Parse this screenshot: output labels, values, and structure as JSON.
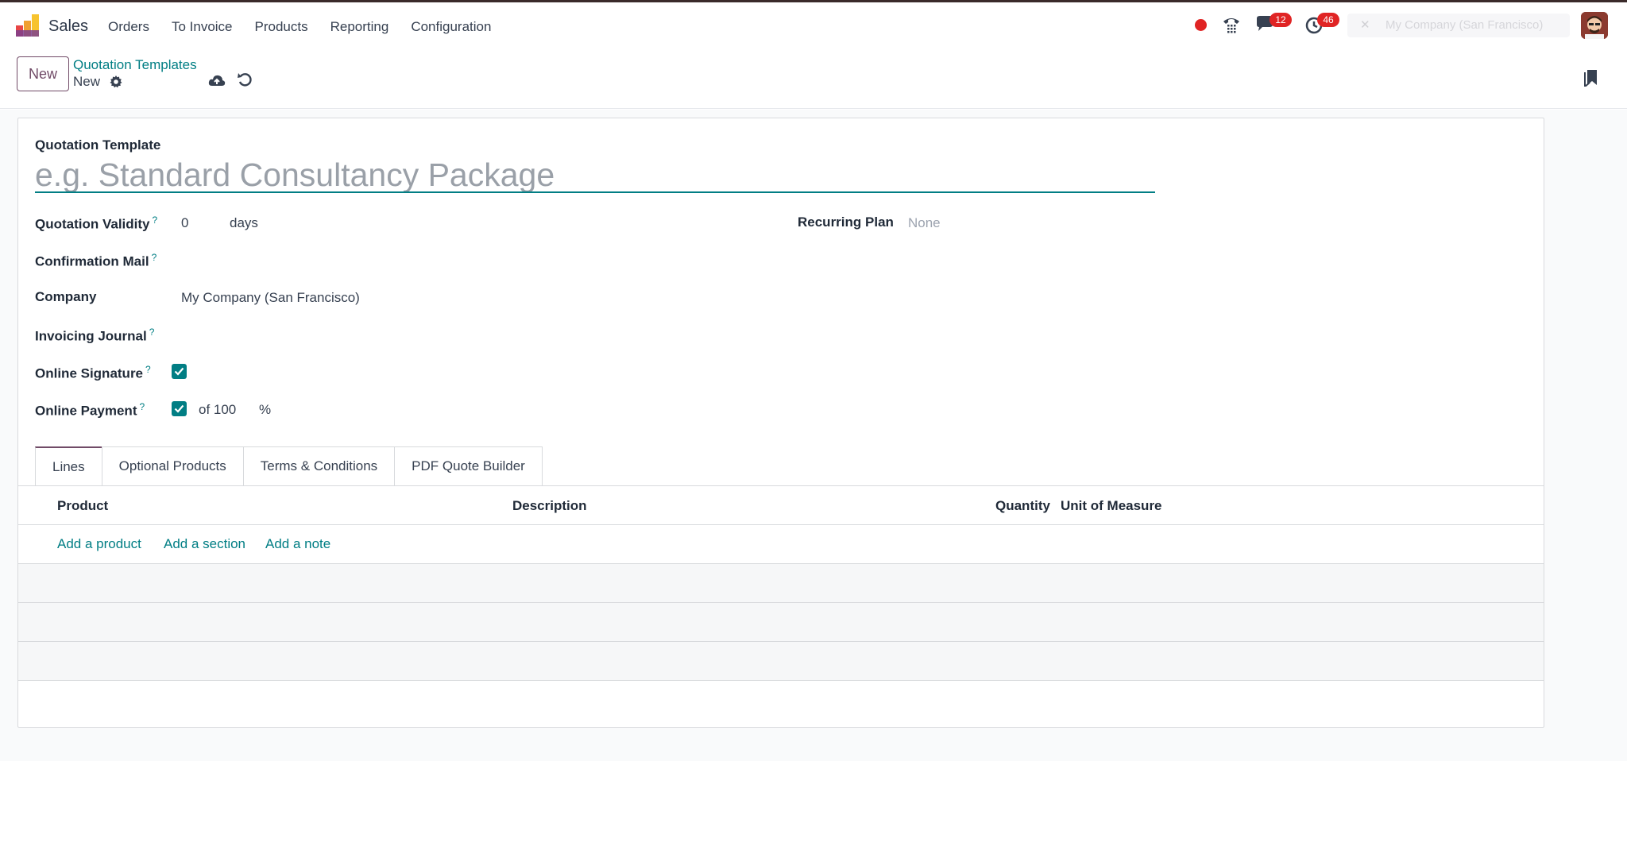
{
  "app": {
    "name": "Sales"
  },
  "menu": [
    "Orders",
    "To Invoice",
    "Products",
    "Reporting",
    "Configuration"
  ],
  "systray": {
    "messages_count": "12",
    "activities_count": "46",
    "company_switcher": "My Company (San Francisco)"
  },
  "control_panel": {
    "new_button": "New",
    "breadcrumb_parent": "Quotation Templates",
    "record_name": "New"
  },
  "form": {
    "template_label": "Quotation Template",
    "template_placeholder": "e.g. Standard Consultancy Package",
    "validity_label": "Quotation Validity",
    "validity_value": "0",
    "validity_unit": "days",
    "recurring_label": "Recurring Plan",
    "recurring_value": "None",
    "confirmation_label": "Confirmation Mail",
    "company_label": "Company",
    "company_value": "My Company (San Francisco)",
    "journal_label": "Invoicing Journal",
    "signature_label": "Online Signature",
    "signature_checked": true,
    "payment_label": "Online Payment",
    "payment_checked": true,
    "payment_of": "of 100",
    "payment_unit": "%",
    "help_mark": "?"
  },
  "tabs": [
    "Lines",
    "Optional Products",
    "Terms & Conditions",
    "PDF Quote Builder"
  ],
  "active_tab": "Lines",
  "lines_table": {
    "columns": [
      "Product",
      "Description",
      "Quantity",
      "Unit of Measure"
    ],
    "actions": [
      "Add a product",
      "Add a section",
      "Add a note"
    ]
  },
  "colors": {
    "accent": "#017e84",
    "brand": "#714b67",
    "badge": "#e02424"
  }
}
